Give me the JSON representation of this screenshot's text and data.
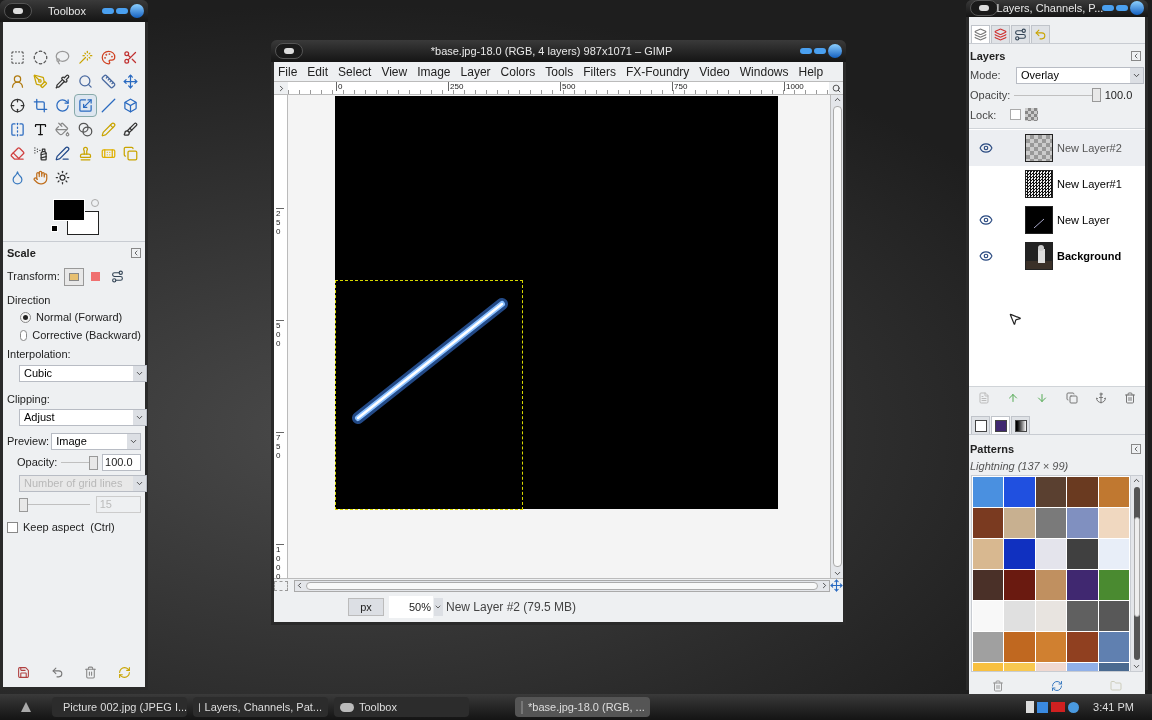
{
  "toolbox": {
    "title": "Toolbox",
    "tools": [
      {
        "selected": false
      },
      {
        "selected": false
      },
      {
        "selected": false
      },
      {
        "selected": false
      },
      {
        "selected": false
      },
      {
        "selected": false
      },
      {
        "selected": false
      },
      {
        "selected": false
      },
      {
        "selected": false
      },
      {
        "selected": false
      },
      {
        "selected": false
      },
      {
        "selected": false
      },
      {
        "selected": false
      },
      {
        "selected": false
      },
      {
        "selected": false
      },
      {
        "selected": true
      },
      {
        "selected": false
      },
      {
        "selected": false
      },
      {
        "selected": false
      },
      {
        "selected": false
      },
      {
        "selected": false
      },
      {
        "selected": false
      },
      {
        "selected": false
      },
      {
        "selected": false
      },
      {
        "selected": false
      },
      {
        "selected": false
      },
      {
        "selected": false
      },
      {
        "selected": false
      },
      {
        "selected": false
      },
      {
        "selected": false
      },
      {
        "selected": false
      },
      {
        "selected": false
      },
      {
        "selected": false
      }
    ],
    "options": {
      "title": "Scale",
      "transform_label": "Transform:",
      "direction_label": "Direction",
      "directions": [
        {
          "label": "Normal (Forward)",
          "selected": true
        },
        {
          "label": "Corrective (Backward)",
          "selected": false
        }
      ],
      "interpolation_label": "Interpolation:",
      "interpolation": "Cubic",
      "clipping_label": "Clipping:",
      "clipping": "Adjust",
      "preview_label": "Preview:",
      "preview": "Image",
      "opacity": {
        "label": "Opacity:",
        "value": "100.0",
        "level": 1
      },
      "grid_lines": {
        "placeholder": "Number of grid lines",
        "value": "15",
        "disabled": true,
        "level": 0
      },
      "keep_aspect": {
        "label": "Keep aspect  (Ctrl)",
        "checked": false
      }
    }
  },
  "image_window": {
    "title": "*base.jpg-18.0 (RGB, 4 layers) 987x1071 – GIMP",
    "menu": [
      "File",
      "Edit",
      "Select",
      "View",
      "Image",
      "Layer",
      "Colors",
      "Tools",
      "Filters",
      "FX-Foundry",
      "Video",
      "Windows",
      "Help"
    ],
    "hruler": [
      "0",
      "250",
      "500",
      "750",
      "1000"
    ],
    "vruler": [
      "250",
      "500",
      "750",
      "1000"
    ],
    "unit": "px",
    "zoom": "50%",
    "status": "New Layer #2 (79.5 MB)"
  },
  "dock": {
    "title": "Layers, Channels, P...",
    "tabs": [
      {
        "selected": true
      },
      {
        "selected": false
      },
      {
        "selected": false
      },
      {
        "selected": false
      }
    ],
    "layers": {
      "title": "Layers",
      "mode_label": "Mode:",
      "mode": "Overlay",
      "opacity": {
        "label": "Opacity:",
        "value": "100.0",
        "level": 1
      },
      "lock_label": "Lock:",
      "lock_pixels": {
        "checked": false
      },
      "items": [
        {
          "name": "New Layer#2",
          "kind": "checker",
          "visible": true,
          "selected": true,
          "has_alpha": true
        },
        {
          "name": "New Layer#1",
          "kind": "noise",
          "visible": false,
          "selected": false,
          "has_alpha": true
        },
        {
          "name": "New Layer",
          "kind": "streak",
          "visible": true,
          "selected": false,
          "has_alpha": true
        },
        {
          "name": "Background",
          "kind": "photo",
          "visible": true,
          "selected": false,
          "has_alpha": false
        }
      ]
    },
    "lower_tabs": [
      {
        "selected": false
      },
      {
        "selected": true
      },
      {
        "selected": false
      }
    ],
    "patterns": {
      "title": "Patterns",
      "current": "Lightning (137 × 99)",
      "swatches": [
        {
          "color": "#4a90e0"
        },
        {
          "color": "#2050e0"
        },
        {
          "color": "#5a4030"
        },
        {
          "color": "#6a3a20"
        },
        {
          "color": "#c07830"
        },
        {
          "color": "#7a3a20"
        },
        {
          "color": "#c8b090"
        },
        {
          "color": "#7a7a7a"
        },
        {
          "color": "#8090c0"
        },
        {
          "color": "#f0d8c0"
        },
        {
          "color": "#d8b890"
        },
        {
          "color": "#1030c0"
        },
        {
          "color": "#e4e4ec"
        },
        {
          "color": "#404040"
        },
        {
          "color": "#e8eef8"
        },
        {
          "color": "#4a3028"
        },
        {
          "color": "#6a1a10"
        },
        {
          "color": "#c09060"
        },
        {
          "color": "#402870"
        },
        {
          "color": "#4a8a30"
        },
        {
          "color": "#f8f8f8"
        },
        {
          "color": "#e0e0e0"
        },
        {
          "color": "#e8e4e0"
        },
        {
          "color": "#606060"
        },
        {
          "color": "#585858"
        },
        {
          "color": "#a0a0a0"
        },
        {
          "color": "#c06820"
        },
        {
          "color": "#d08030"
        },
        {
          "color": "#904020"
        },
        {
          "color": "#6080b0"
        },
        {
          "color": "#f8c040"
        },
        {
          "color": "#f8c850"
        },
        {
          "color": "#f0d8d0"
        },
        {
          "color": "#90b0e8"
        },
        {
          "color": "#4a6a90"
        }
      ]
    }
  },
  "taskbar": {
    "items": [
      {
        "label": "Picture 002.jpg (JPEG I...",
        "kind": "browser",
        "selected": false
      },
      {
        "label": "Layers, Channels, Pat...",
        "kind": "gimp",
        "selected": false
      },
      {
        "label": "Toolbox",
        "kind": "gimp",
        "selected": false
      },
      {
        "label": "*base.jpg-18.0 (RGB, ...",
        "kind": "image",
        "selected": true
      }
    ],
    "clock": "3:41 PM"
  }
}
